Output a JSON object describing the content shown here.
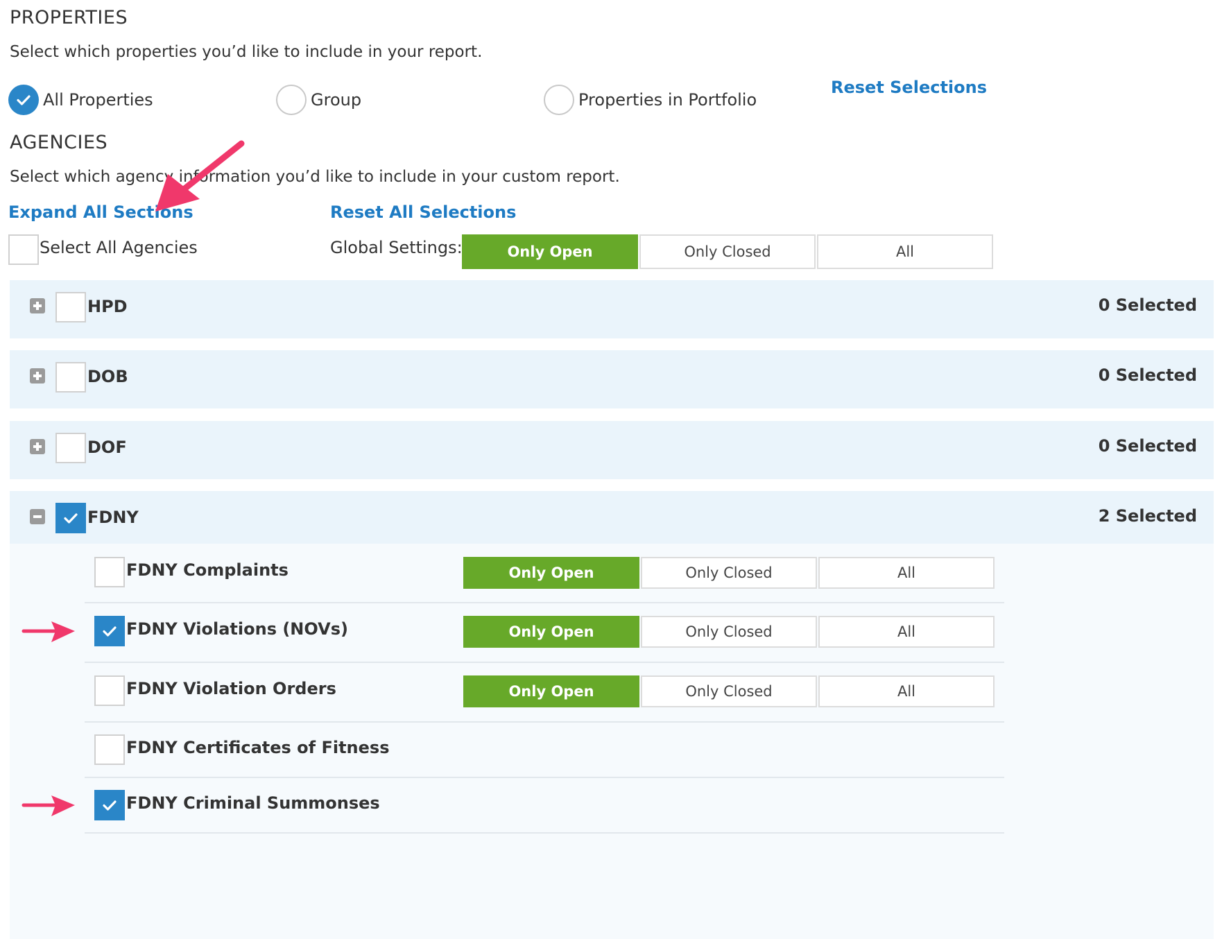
{
  "properties": {
    "title": "PROPERTIES",
    "description": "Select which properties you’d like to include in your report.",
    "options": [
      {
        "label": "All Properties",
        "selected": true
      },
      {
        "label": "Group",
        "selected": false
      },
      {
        "label": "Properties in Portfolio",
        "selected": false
      }
    ],
    "reset_label": "Reset Selections"
  },
  "agencies": {
    "title": "AGENCIES",
    "description": "Select which agency information you’d like to include in your custom report.",
    "expand_all_label": "Expand All Sections",
    "reset_all_label": "Reset All Selections",
    "select_all_label": "Select All Agencies",
    "global_settings_label": "Global Settings:",
    "filter_options": [
      "Only Open",
      "Only Closed",
      "All"
    ],
    "global_active": "Only Open",
    "list": [
      {
        "name": "HPD",
        "count_label": "0 Selected",
        "checked": false,
        "expanded": false
      },
      {
        "name": "DOB",
        "count_label": "0 Selected",
        "checked": false,
        "expanded": false
      },
      {
        "name": "DOF",
        "count_label": "0 Selected",
        "checked": false,
        "expanded": false
      },
      {
        "name": "FDNY",
        "count_label": "2 Selected",
        "checked": true,
        "expanded": true
      }
    ],
    "fdny_items": [
      {
        "label": "FDNY Complaints",
        "checked": false,
        "has_filter": true,
        "active": "Only Open"
      },
      {
        "label": "FDNY Violations (NOVs)",
        "checked": true,
        "has_filter": true,
        "active": "Only Open"
      },
      {
        "label": "FDNY Violation Orders",
        "checked": false,
        "has_filter": true,
        "active": "Only Open"
      },
      {
        "label": "FDNY Certificates of Fitness",
        "checked": false,
        "has_filter": false
      },
      {
        "label": "FDNY Criminal Summonses",
        "checked": true,
        "has_filter": false
      }
    ]
  },
  "colors": {
    "accent_blue": "#2a86c8",
    "link_blue": "#1e7bc3",
    "active_green": "#67a929",
    "band_bg": "#eaf4fb",
    "annotation_pink": "#f0386b"
  },
  "icons": {
    "check": "check-icon",
    "plus": "plus-square-icon",
    "minus": "minus-square-icon",
    "annotation": "annotation-arrow-icon"
  }
}
